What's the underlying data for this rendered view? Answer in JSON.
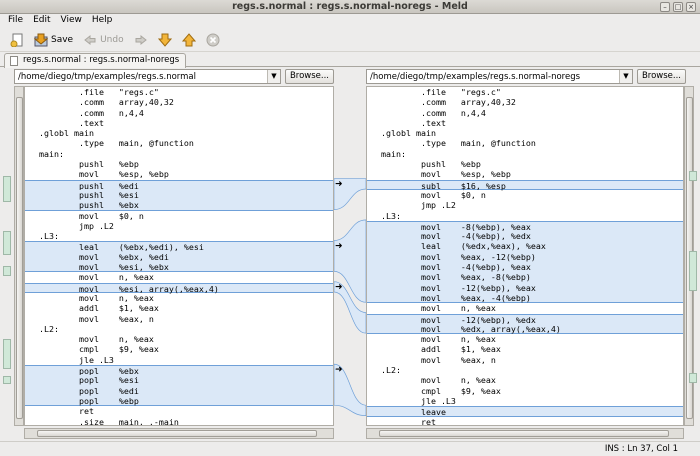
{
  "window": {
    "title": "regs.s.normal : regs.s.normal-noregs - Meld"
  },
  "menu": [
    "File",
    "Edit",
    "View",
    "Help"
  ],
  "toolbar": {
    "save_label": "Save",
    "undo_label": "Undo"
  },
  "tab": {
    "label": "regs.s.normal : regs.s.normal-noregs"
  },
  "left": {
    "path": "/home/diego/tmp/examples/regs.s.normal",
    "browse_label": "Browse...",
    "lines": [
      {
        "t": "\t.file\t\"regs.c\"",
        "k": ""
      },
      {
        "t": "\t.comm\tarray,40,32",
        "k": ""
      },
      {
        "t": "\t.comm\tn,4,4",
        "k": ""
      },
      {
        "t": "\t.text",
        "k": ""
      },
      {
        "t": ".globl main",
        "k": ""
      },
      {
        "t": "\t.type\tmain, @function",
        "k": ""
      },
      {
        "t": "main:",
        "k": ""
      },
      {
        "t": "\tpushl\t%ebp",
        "k": ""
      },
      {
        "t": "\tmovl\t%esp, %ebp",
        "k": ""
      },
      {
        "t": "\tpushl\t%edi",
        "k": "chg"
      },
      {
        "t": "\tpushl\t%esi",
        "k": "chg"
      },
      {
        "t": "\tpushl\t%ebx",
        "k": "chg"
      },
      {
        "t": "\tmovl\t$0, n",
        "k": ""
      },
      {
        "t": "\tjmp .L2",
        "k": ""
      },
      {
        "t": ".L3:",
        "k": ""
      },
      {
        "t": "\tleal\t(%ebx,%edi), %esi",
        "k": "chg"
      },
      {
        "t": "\tmovl\t%ebx, %edi",
        "k": "chg"
      },
      {
        "t": "\tmovl\t%esi, %ebx",
        "k": "chg"
      },
      {
        "t": "\tmovl\tn, %eax",
        "k": ""
      },
      {
        "t": "\tmovl\t%esi, array(,%eax,4)",
        "k": "chg"
      },
      {
        "t": "\tmovl\tn, %eax",
        "k": ""
      },
      {
        "t": "\taddl\t$1, %eax",
        "k": ""
      },
      {
        "t": "\tmovl\t%eax, n",
        "k": ""
      },
      {
        "t": ".L2:",
        "k": ""
      },
      {
        "t": "\tmovl\tn, %eax",
        "k": ""
      },
      {
        "t": "\tcmpl\t$9, %eax",
        "k": ""
      },
      {
        "t": "\tjle .L3",
        "k": ""
      },
      {
        "t": "\tpopl\t%ebx",
        "k": "chg"
      },
      {
        "t": "\tpopl\t%esi",
        "k": "chg"
      },
      {
        "t": "\tpopl\t%edi",
        "k": "chg"
      },
      {
        "t": "\tpopl\t%ebp",
        "k": "chg"
      },
      {
        "t": "\tret",
        "k": ""
      },
      {
        "t": "\t.size\tmain, .-main",
        "k": ""
      }
    ]
  },
  "right": {
    "path": "/home/diego/tmp/examples/regs.s.normal-noregs",
    "browse_label": "Browse...",
    "lines": [
      {
        "t": "\t.file\t\"regs.c\"",
        "k": ""
      },
      {
        "t": "\t.comm\tarray,40,32",
        "k": ""
      },
      {
        "t": "\t.comm\tn,4,4",
        "k": ""
      },
      {
        "t": "\t.text",
        "k": ""
      },
      {
        "t": ".globl main",
        "k": ""
      },
      {
        "t": "\t.type\tmain, @function",
        "k": ""
      },
      {
        "t": "main:",
        "k": ""
      },
      {
        "t": "\tpushl\t%ebp",
        "k": ""
      },
      {
        "t": "\tmovl\t%esp, %ebp",
        "k": ""
      },
      {
        "t": "\tsubl\t$16, %esp",
        "k": "chg"
      },
      {
        "t": "\tmovl\t$0, n",
        "k": ""
      },
      {
        "t": "\tjmp .L2",
        "k": ""
      },
      {
        "t": ".L3:",
        "k": ""
      },
      {
        "t": "\tmovl\t-8(%ebp), %eax",
        "k": "chg"
      },
      {
        "t": "\tmovl\t-4(%ebp), %edx",
        "k": "chg"
      },
      {
        "t": "\tleal\t(%edx,%eax), %eax",
        "k": "chg"
      },
      {
        "t": "\tmovl\t%eax, -12(%ebp)",
        "k": "chg"
      },
      {
        "t": "\tmovl\t-4(%ebp), %eax",
        "k": "chg"
      },
      {
        "t": "\tmovl\t%eax, -8(%ebp)",
        "k": "chg"
      },
      {
        "t": "\tmovl\t-12(%ebp), %eax",
        "k": "chg"
      },
      {
        "t": "\tmovl\t%eax, -4(%ebp)",
        "k": "chg"
      },
      {
        "t": "\tmovl\tn, %eax",
        "k": ""
      },
      {
        "t": "\tmovl\t-12(%ebp), %edx",
        "k": "chg"
      },
      {
        "t": "\tmovl\t%edx, array(,%eax,4)",
        "k": "chg"
      },
      {
        "t": "\tmovl\tn, %eax",
        "k": ""
      },
      {
        "t": "\taddl\t$1, %eax",
        "k": ""
      },
      {
        "t": "\tmovl\t%eax, n",
        "k": ""
      },
      {
        "t": ".L2:",
        "k": ""
      },
      {
        "t": "\tmovl\tn, %eax",
        "k": ""
      },
      {
        "t": "\tcmpl\t$9, %eax",
        "k": ""
      },
      {
        "t": "\tjle .L3",
        "k": ""
      },
      {
        "t": "\tleave",
        "k": "chg"
      },
      {
        "t": "\tret",
        "k": ""
      }
    ]
  },
  "status": {
    "position": "INS : Ln 37, Col 1"
  },
  "colors": {
    "change_bg": "#dbe8f7",
    "change_text": "#d00000",
    "change_border": "#6fa0d8"
  }
}
